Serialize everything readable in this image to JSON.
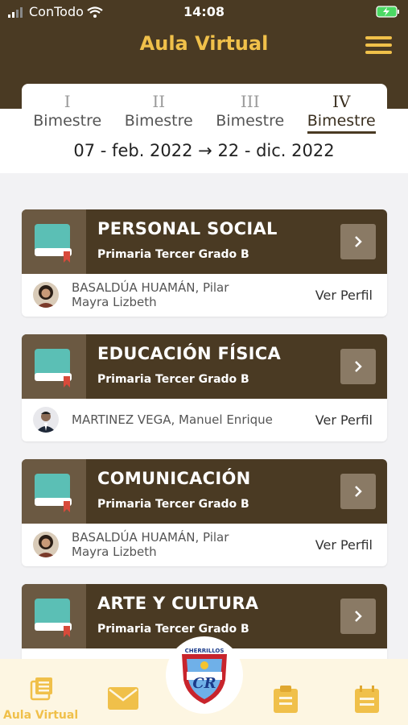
{
  "status": {
    "carrier": "ConTodo",
    "time": "14:08"
  },
  "header": {
    "title": "Aula Virtual"
  },
  "tabs": [
    {
      "roman": "I",
      "label": "Bimestre",
      "active": false
    },
    {
      "roman": "II",
      "label": "Bimestre",
      "active": false
    },
    {
      "roman": "III",
      "label": "Bimestre",
      "active": false
    },
    {
      "roman": "IV",
      "label": "Bimestre",
      "active": true
    }
  ],
  "date_range": "07 - feb. 2022 → 22 - dic. 2022",
  "courses": [
    {
      "name": "PERSONAL SOCIAL",
      "grade": "Primaria Tercer Grado B",
      "teacher_line1": "BASALDÚA HUAMÁN, Pilar",
      "teacher_line2": "Mayra Lizbeth",
      "profile": "Ver Perfil"
    },
    {
      "name": "EDUCACIÓN FÍSICA",
      "grade": "Primaria Tercer Grado B",
      "teacher_line1": "MARTINEZ VEGA, Manuel Enrique",
      "teacher_line2": "",
      "profile": "Ver Perfil"
    },
    {
      "name": "COMUNICACIÓN",
      "grade": "Primaria Tercer Grado B",
      "teacher_line1": "BASALDÚA HUAMÁN, Pilar",
      "teacher_line2": "Mayra Lizbeth",
      "profile": "Ver Perfil"
    },
    {
      "name": "ARTE Y CULTURA",
      "grade": "Primaria Tercer Grado B",
      "teacher_line1": "",
      "teacher_line2": "",
      "profile": ""
    }
  ],
  "tabbar": {
    "active_label": "Aula Virtual",
    "logo_text": "CHERRILLOS"
  },
  "colors": {
    "brown": "#4a3a23",
    "gold": "#f0c04a",
    "book": "#5bbfb5"
  }
}
